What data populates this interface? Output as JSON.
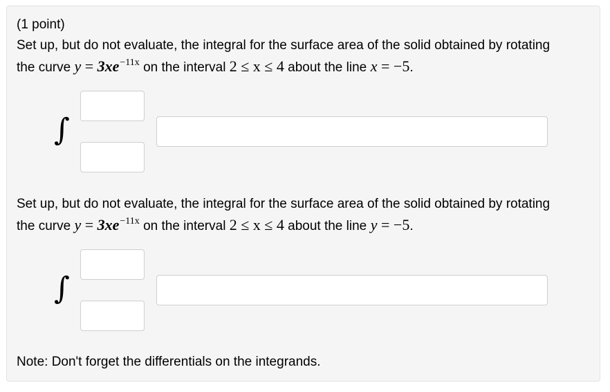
{
  "points": "(1 point)",
  "problems": [
    {
      "text_a": "Set up, but do not evaluate, the integral for the surface area of the solid obtained by rotating the curve",
      "curve_lhs": "y",
      "curve_eq": " = ",
      "curve_coef": "3",
      "curve_x": "x",
      "curve_e": "e",
      "curve_exp": "−11x",
      "text_b": "on the interval",
      "interval": "2 ≤ x ≤ 4",
      "text_c": "about the line",
      "line_var": "x",
      "line_eq": " = −5",
      "period": ".",
      "integral_sign": "∫",
      "upper_limit": "",
      "lower_limit": "",
      "integrand": ""
    },
    {
      "text_a": "Set up, but do not evaluate, the integral for the surface area of the solid obtained by rotating the curve",
      "curve_lhs": "y",
      "curve_eq": " = ",
      "curve_coef": "3",
      "curve_x": "x",
      "curve_e": "e",
      "curve_exp": "−11x",
      "text_b": "on the interval",
      "interval": "2 ≤ x ≤ 4",
      "text_c": "about the line",
      "line_var": "y",
      "line_eq": " = −5",
      "period": ".",
      "integral_sign": "∫",
      "upper_limit": "",
      "lower_limit": "",
      "integrand": ""
    }
  ],
  "note": "Note: Don't forget the differentials on the integrands."
}
